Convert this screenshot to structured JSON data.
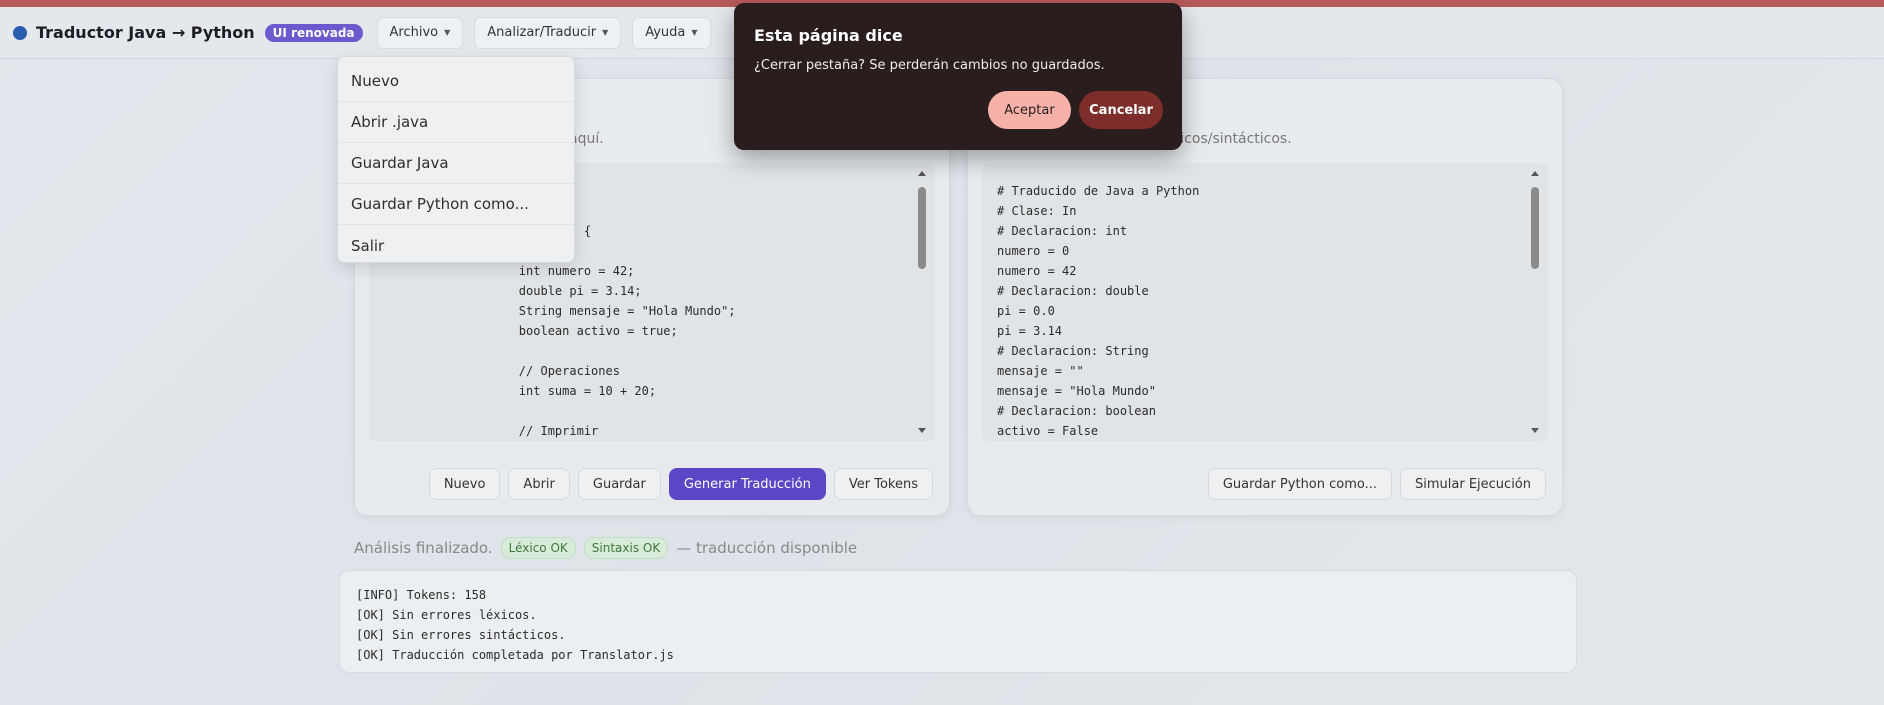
{
  "navbar": {
    "title": "Traductor Java → Python",
    "badge": "UI renovada",
    "menus": [
      {
        "label": "Archivo"
      },
      {
        "label": "Analizar/Traducir"
      },
      {
        "label": "Ayuda"
      }
    ]
  },
  "file_menu": {
    "items": [
      "Nuevo",
      "Abrir .java",
      "Guardar Java",
      "Guardar Python como...",
      "Salir"
    ]
  },
  "left_panel": {
    "subtitle": "aquí.",
    "code": "n(String[] args) {\n\n        int numero = 42;\n        double pi = 3.14;\n        String mensaje = \"Hola Mundo\";\n        boolean activo = true;\n\n        // Operaciones\n        int suma = 10 + 20;\n\n        // Imprimir",
    "buttons": [
      "Nuevo",
      "Abrir",
      "Guardar",
      "Generar Traducción",
      "Ver Tokens"
    ]
  },
  "right_panel": {
    "subtitle": "s léxicos/sintácticos.",
    "code": "# Traducido de Java a Python\n# Clase: In\n# Declaracion: int\nnumero = 0\nnumero = 42\n# Declaracion: double\npi = 0.0\npi = 3.14\n# Declaracion: String\nmensaje = \"\"\nmensaje = \"Hola Mundo\"\n# Declaracion: boolean\nactivo = False",
    "buttons": [
      "Guardar Python como...",
      "Simular Ejecución"
    ]
  },
  "status": {
    "text": "Análisis finalizado.",
    "lex": "Léxico OK",
    "syn": "Sintaxis OK",
    "suffix": "— traducción disponible"
  },
  "console": {
    "lines": "[INFO] Tokens: 158\n[OK] Sin errores léxicos.\n[OK] Sin errores sintácticos.\n[OK] Traducción completada por Translator.js"
  },
  "dialog": {
    "title": "Esta página dice",
    "message": "¿Cerrar pestaña? Se perderán cambios no guardados.",
    "ok": "Aceptar",
    "cancel": "Cancelar"
  },
  "colors": {
    "accent": "#5b46c6",
    "badge": "#6a5acd",
    "dialog_bg": "#2a1d1d",
    "ok_button": "#f6b1a9",
    "cancel_button": "#7d2e2b",
    "ok_pill": "#d8ead8"
  }
}
